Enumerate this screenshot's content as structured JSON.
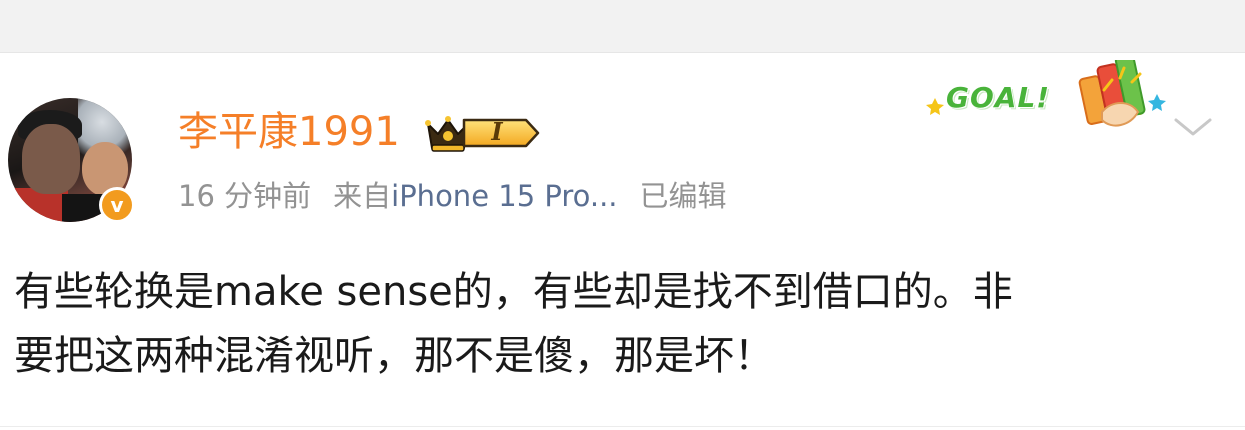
{
  "post": {
    "author": {
      "name": "李平康1991",
      "verified_mark": "v",
      "vip_level": "I"
    },
    "meta": {
      "time": "16 分钟前",
      "source": "来自",
      "device": "iPhone 15 Pro...",
      "edited": "已编辑"
    },
    "badge": {
      "text": "GOAL!"
    },
    "content": {
      "lines": [
        "有些轮换是make sense的，有些却是找不到借口的。非",
        "要把这两种混淆视听，那不是傻，那是坏！"
      ]
    }
  },
  "colors": {
    "username": "#f57f28",
    "meta": "#939393",
    "device": "#5a6e91",
    "verified": "#f29b1e",
    "goal": "#49b33a",
    "top_bar": "#f2f2f2"
  },
  "icons": {
    "crown": "crown-icon",
    "more": "chevron-down-icon",
    "verified": "verified-v-icon"
  }
}
